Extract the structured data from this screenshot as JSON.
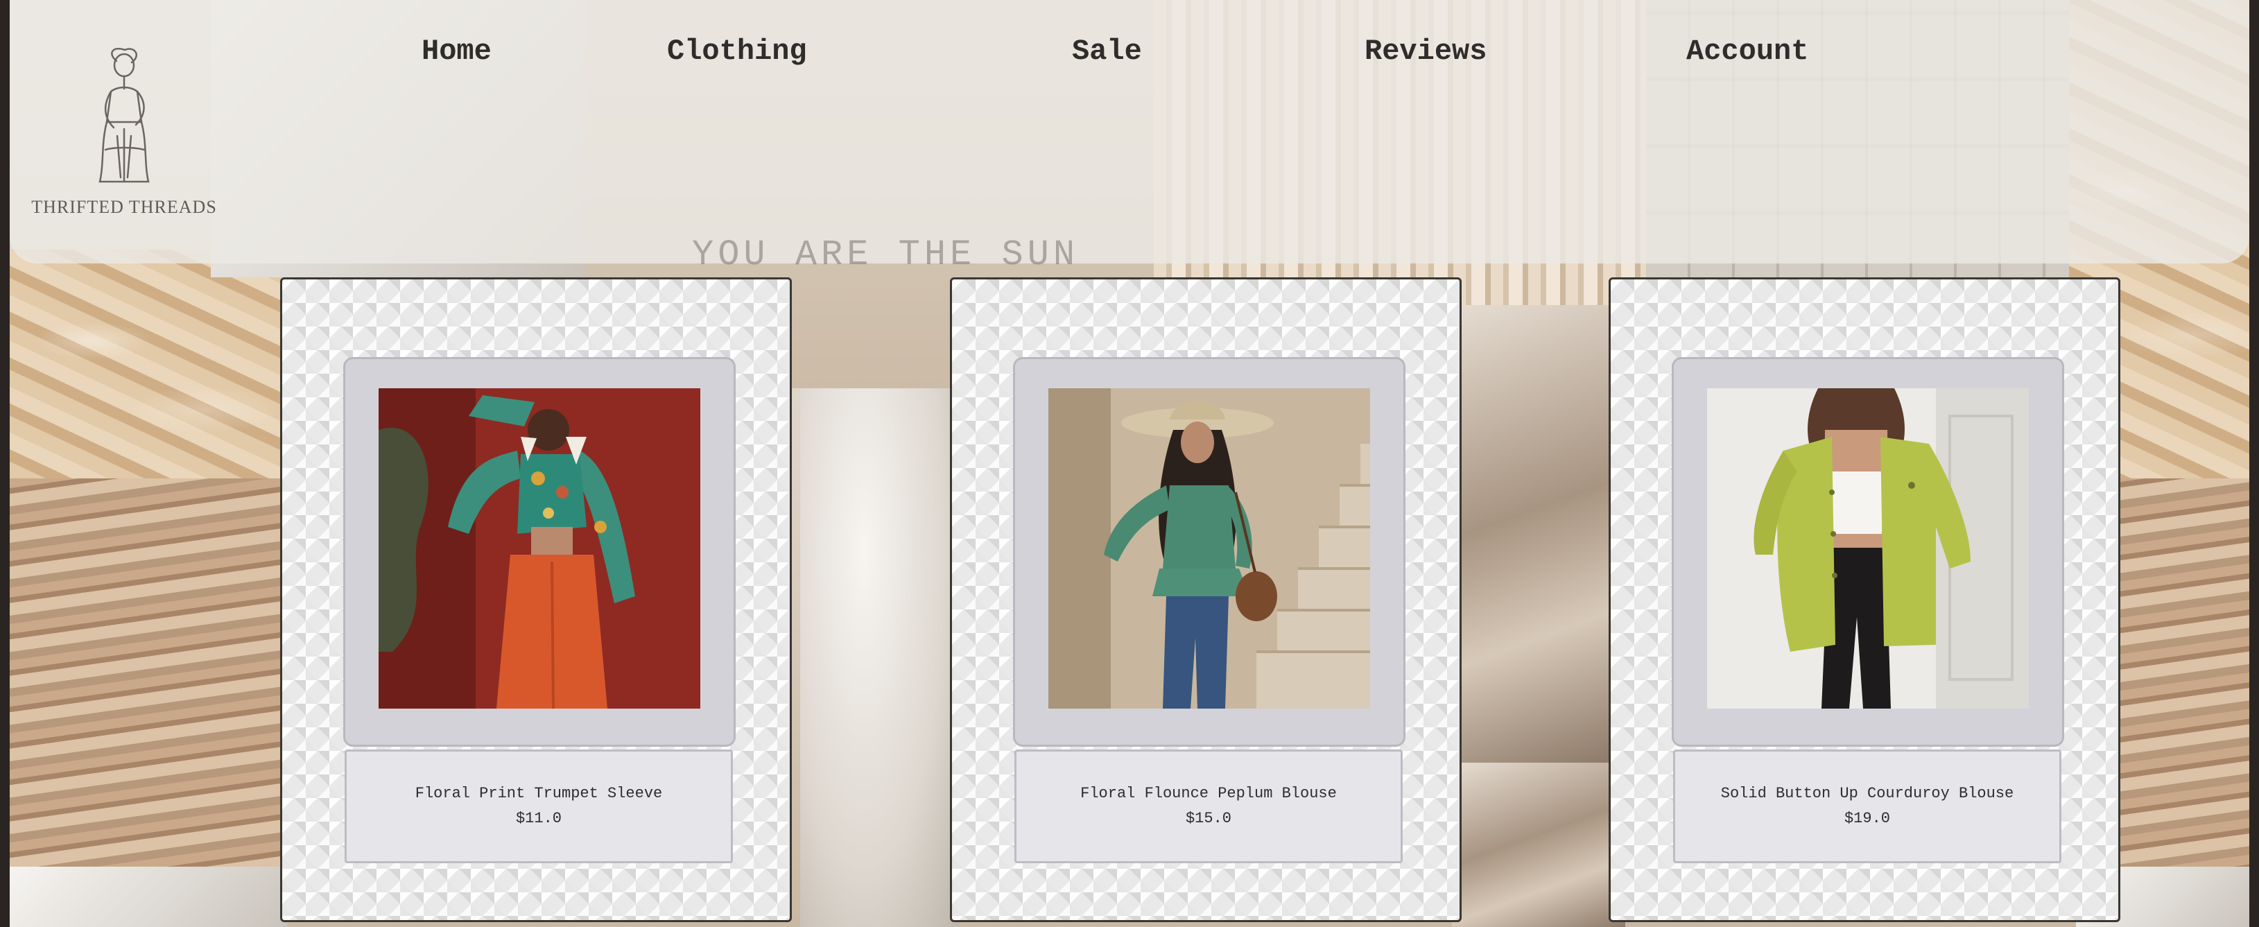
{
  "brand": {
    "logo_text": "THRIFTED THREADS"
  },
  "nav": {
    "items": [
      {
        "id": "home",
        "label": "Home"
      },
      {
        "id": "clothing",
        "label": "Clothing"
      },
      {
        "id": "sale",
        "label": "Sale"
      },
      {
        "id": "reviews",
        "label": "Reviews"
      },
      {
        "id": "account",
        "label": "Account"
      }
    ]
  },
  "hero": {
    "tagline": "YOU ARE THE SUN"
  },
  "products": [
    {
      "name": "Floral Print Trumpet Sleeve",
      "price": "$11.0",
      "photo": "model-in-floral-crop-top-and-orange-pants"
    },
    {
      "name": "Floral Flounce Peplum Blouse",
      "price": "$15.0",
      "photo": "model-in-green-peplum-blouse-and-sun-hat"
    },
    {
      "name": "Solid Button Up Courduroy Blouse",
      "price": "$19.0",
      "photo": "model-in-lime-corduroy-overshirt"
    }
  ],
  "colors": {
    "header_bg": "#ece9e4",
    "nav_text": "#2f2d2b",
    "card_border": "#3a3733",
    "photo_frame": "#d3d2d8",
    "info_box": "#e6e5ea"
  }
}
